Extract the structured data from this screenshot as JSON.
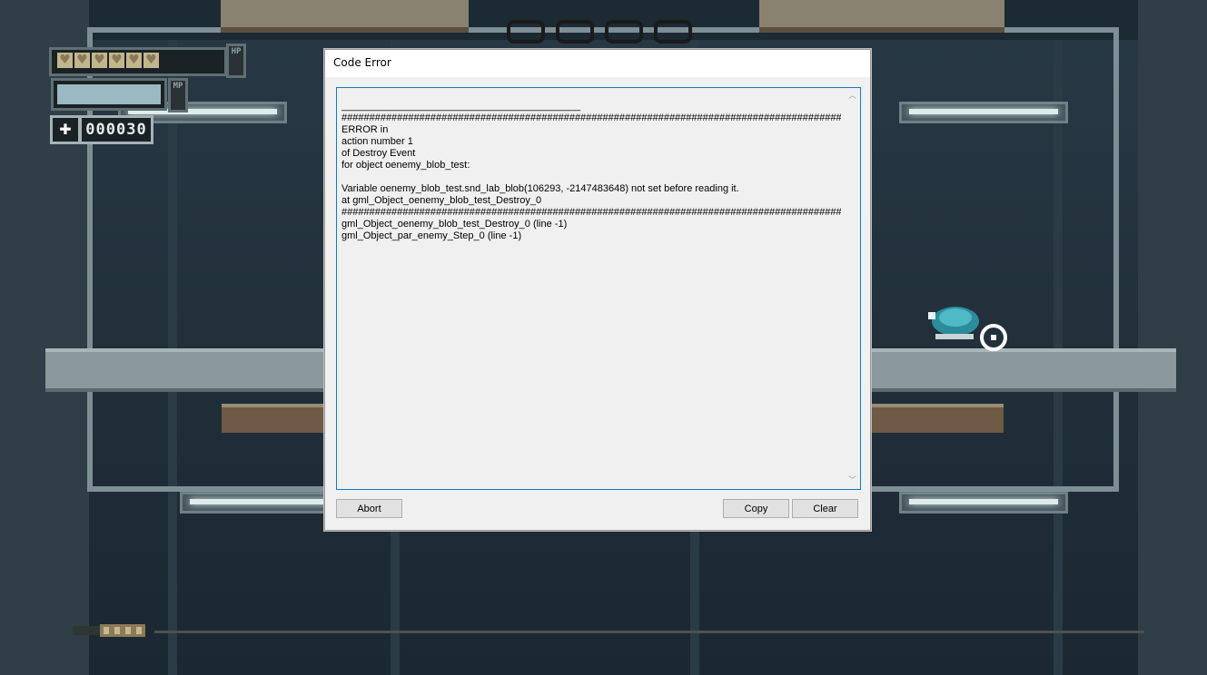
{
  "hud": {
    "hp_label": "HP",
    "mp_label": "MP",
    "hearts": [
      "♥",
      "♥",
      "♥",
      "♥",
      "♥",
      "♥"
    ],
    "mp_fill_fraction": 1.0,
    "ammo_icon": "✚",
    "ammo_count": "000030"
  },
  "dialog": {
    "title": "Code Error",
    "log": "___________________________________________\n####################################################################################################\nERROR in\naction number 1\nof Destroy Event\nfor object oenemy_blob_test:\n\nVariable oenemy_blob_test.snd_lab_blob(106293, -2147483648) not set before reading it.\nat gml_Object_oenemy_blob_test_Destroy_0\n####################################################################################################\ngml_Object_oenemy_blob_test_Destroy_0 (line -1)\ngml_Object_par_enemy_Step_0 (line -1)",
    "scroll_up": "︿",
    "scroll_down": "﹀",
    "abort_label": "Abort",
    "copy_label": "Copy",
    "clear_label": "Clear"
  },
  "colors": {
    "dialog_bg": "#f0f0f0",
    "focus_border": "#0f79c9",
    "button_bg": "#e1e1e1"
  },
  "icons": {
    "ammo": "ammo-icon",
    "crosshair": "crosshair-icon",
    "enemy": "blob-enemy"
  }
}
